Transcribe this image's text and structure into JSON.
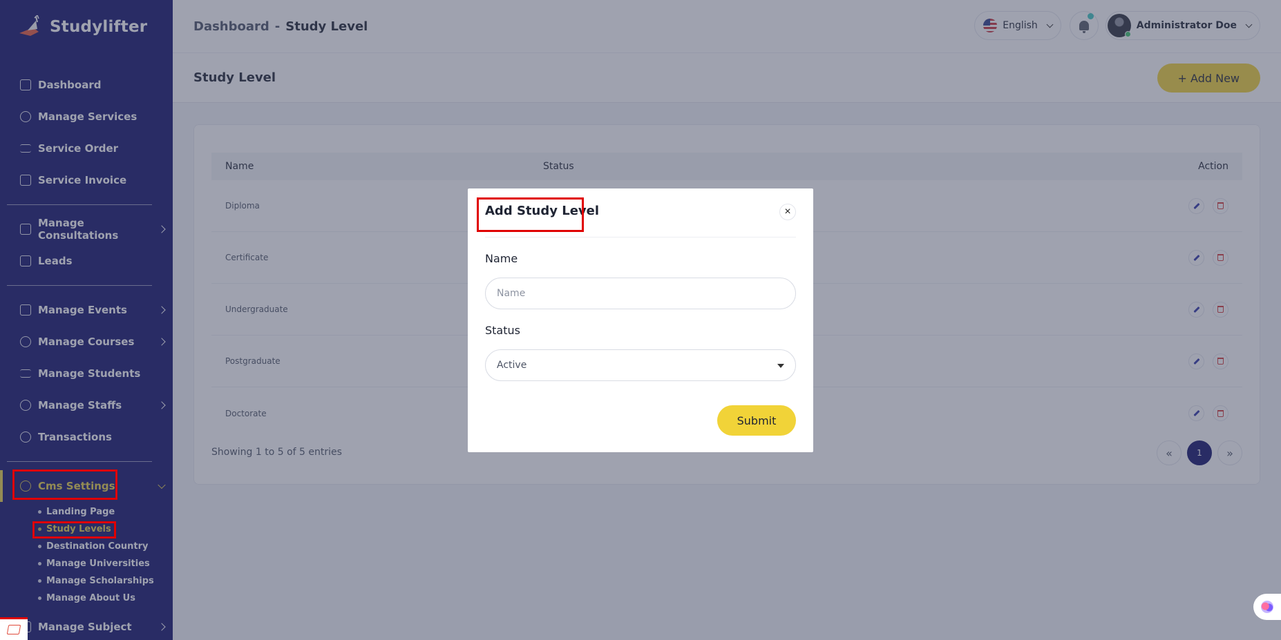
{
  "brand": {
    "name": "Studylifter"
  },
  "sidebar": {
    "items": [
      {
        "label": "Dashboard",
        "icon": "dashboard-icon"
      },
      {
        "label": "Manage Services",
        "icon": "services-icon"
      },
      {
        "label": "Service Order",
        "icon": "order-icon"
      },
      {
        "label": "Service Invoice",
        "icon": "invoice-icon"
      },
      {
        "label": "Manage Consultations",
        "icon": "consultation-icon"
      },
      {
        "label": "Leads",
        "icon": "leads-icon"
      },
      {
        "label": "Manage Events",
        "icon": "calendar-icon"
      },
      {
        "label": "Manage Courses",
        "icon": "courses-icon"
      },
      {
        "label": "Manage Students",
        "icon": "students-icon"
      },
      {
        "label": "Manage Staffs",
        "icon": "staff-icon"
      },
      {
        "label": "Transactions",
        "icon": "transactions-icon"
      },
      {
        "label": "Cms Settings",
        "icon": "settings-icon"
      },
      {
        "label": "Manage Subject",
        "icon": "subject-icon"
      }
    ],
    "cms_sub": [
      {
        "label": "Landing Page"
      },
      {
        "label": "Study Levels"
      },
      {
        "label": "Destination Country"
      },
      {
        "label": "Manage Universities"
      },
      {
        "label": "Manage Scholarships"
      },
      {
        "label": "Manage About Us"
      }
    ]
  },
  "header": {
    "breadcrumb_root": "Dashboard",
    "breadcrumb_sep": "-",
    "breadcrumb_current": "Study Level",
    "language": "English",
    "user_name": "Administrator Doe"
  },
  "page": {
    "title": "Study Level",
    "add_button": "+ Add New"
  },
  "table": {
    "columns": [
      "Name",
      "Status",
      "Action"
    ],
    "rows": [
      {
        "name": "Diploma"
      },
      {
        "name": "Certificate"
      },
      {
        "name": "Undergraduate"
      },
      {
        "name": "Postgraduate"
      },
      {
        "name": "Doctorate"
      }
    ],
    "footer": "Showing 1 to 5 of 5 entries",
    "pager": {
      "prev": "«",
      "current": "1",
      "next": "»"
    }
  },
  "modal": {
    "title": "Add Study Level",
    "close": "×",
    "name_label": "Name",
    "name_placeholder": "Name",
    "name_value": "",
    "status_label": "Status",
    "status_value": "Active",
    "submit": "Submit"
  },
  "colors": {
    "sidebar_bg": "#12136b",
    "accent": "#f1d338",
    "active_text": "#e6d048",
    "highlight": "#e00000"
  }
}
